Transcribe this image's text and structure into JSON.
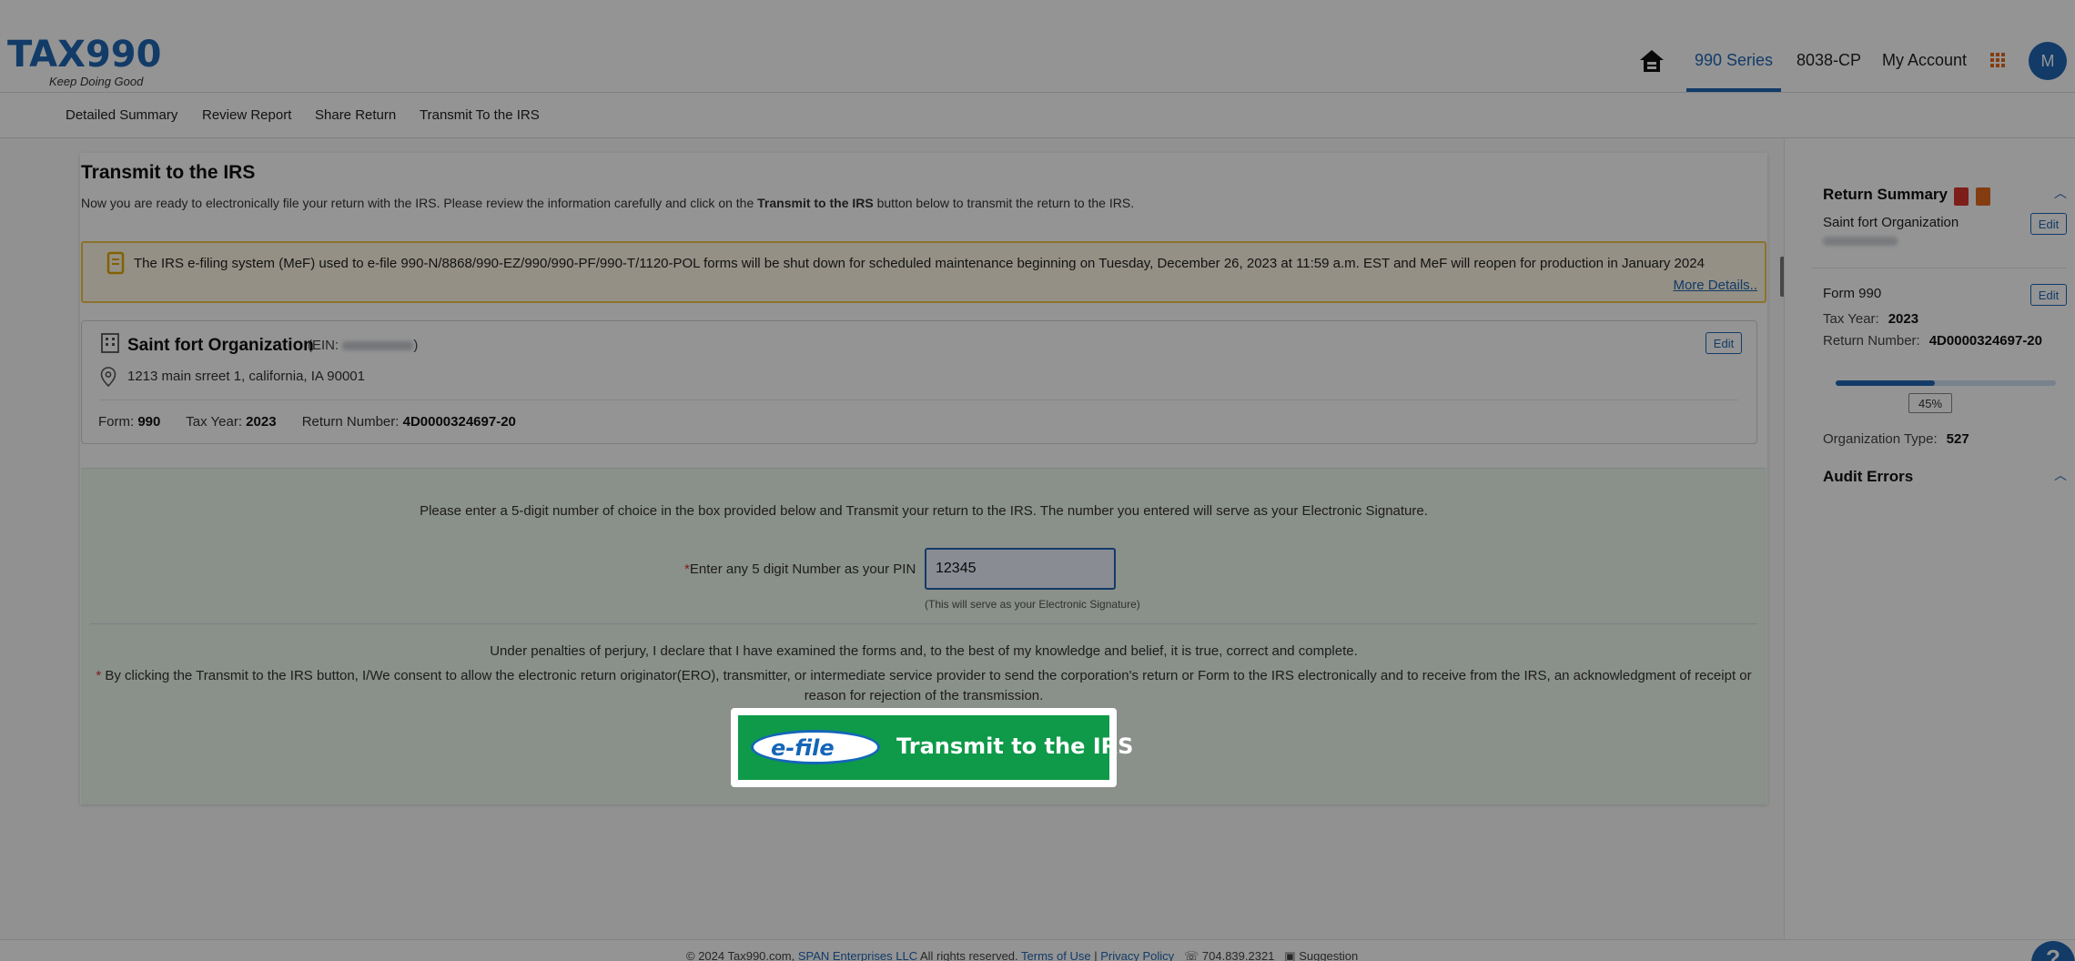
{
  "brand": {
    "logo": "TAX990",
    "tagline": "Keep Doing Good"
  },
  "nav": {
    "items": [
      "990 Series",
      "8038-CP",
      "My Account"
    ],
    "active": "990 Series",
    "avatar": "M"
  },
  "subnav": [
    "Detailed Summary",
    "Review Report",
    "Share Return",
    "Transmit To the IRS"
  ],
  "page": {
    "title": "Transmit to the IRS",
    "desc_pre": "Now you are ready to electronically file your return with the IRS. Please review the information carefully and click on the ",
    "desc_bold": "Transmit to the IRS",
    "desc_post": " button below to transmit the return to the IRS."
  },
  "alert": {
    "text": "The IRS e-filing system (MeF) used to e-file 990-N/8868/990-EZ/990/990-PF/990-T/1120-POL forms will be shut down for scheduled maintenance beginning on Tuesday, December 26, 2023 at 11:59 a.m. EST and MeF will reopen for production in January 2024",
    "link": "More Details.."
  },
  "org": {
    "name": "Saint fort Organization",
    "ein_prefix": "(EIN:",
    "ein_suffix": ")",
    "edit": "Edit",
    "address": "1213 main srreet 1, california, IA 90001",
    "form_label": "Form:",
    "form_value": "990",
    "tax_year_label": "Tax Year:",
    "tax_year_value": "2023",
    "return_label": "Return Number:",
    "return_value": "4D0000324697-20"
  },
  "pin": {
    "intro": "Please enter a 5-digit number of choice in the box provided below and Transmit your return to the IRS. The number you entered will serve as your Electronic Signature.",
    "required_mark": "*",
    "label": "Enter any 5 digit Number as your PIN",
    "value": "12345",
    "hint": "(This will serve as your Electronic Signature)",
    "perjury": "Under penalties of perjury, I declare that I have examined the forms and, to the best of my knowledge and belief, it is true, correct and complete.",
    "consent": "By clicking the Transmit to the IRS button, I/We consent to allow the electronic return originator(ERO), transmitter, or intermediate service provider to send the corporation's return or Form to the IRS electronically and to receive from the IRS, an acknowledgment of receipt or reason for rejection of the transmission."
  },
  "transmit": {
    "efile": "e-file",
    "label": "Transmit to the IRS"
  },
  "sidebar": {
    "title": "Return Summary",
    "org_name": "Saint fort Organization",
    "edit": "Edit",
    "form": "Form 990",
    "tax_year_label": "Tax Year:",
    "tax_year_value": "2023",
    "return_label": "Return Number:",
    "return_value": "4D0000324697-20",
    "progress": 45,
    "progress_label": "45%",
    "org_type_label": "Organization Type:",
    "org_type_value": "527",
    "audit_title": "Audit Errors"
  },
  "footer": {
    "copy": "© 2024 Tax990.com,",
    "company": "SPAN Enterprises LLC",
    "rights": "All rights reserved.",
    "terms": "Terms of Use",
    "privacy": "Privacy Policy",
    "phone": "704.839.2321",
    "suggestion": "Suggestion"
  },
  "help": "?",
  "colors": {
    "brand": "#1f66b3",
    "efile_green": "#0e9a49",
    "alert_border": "#f1c64a"
  }
}
